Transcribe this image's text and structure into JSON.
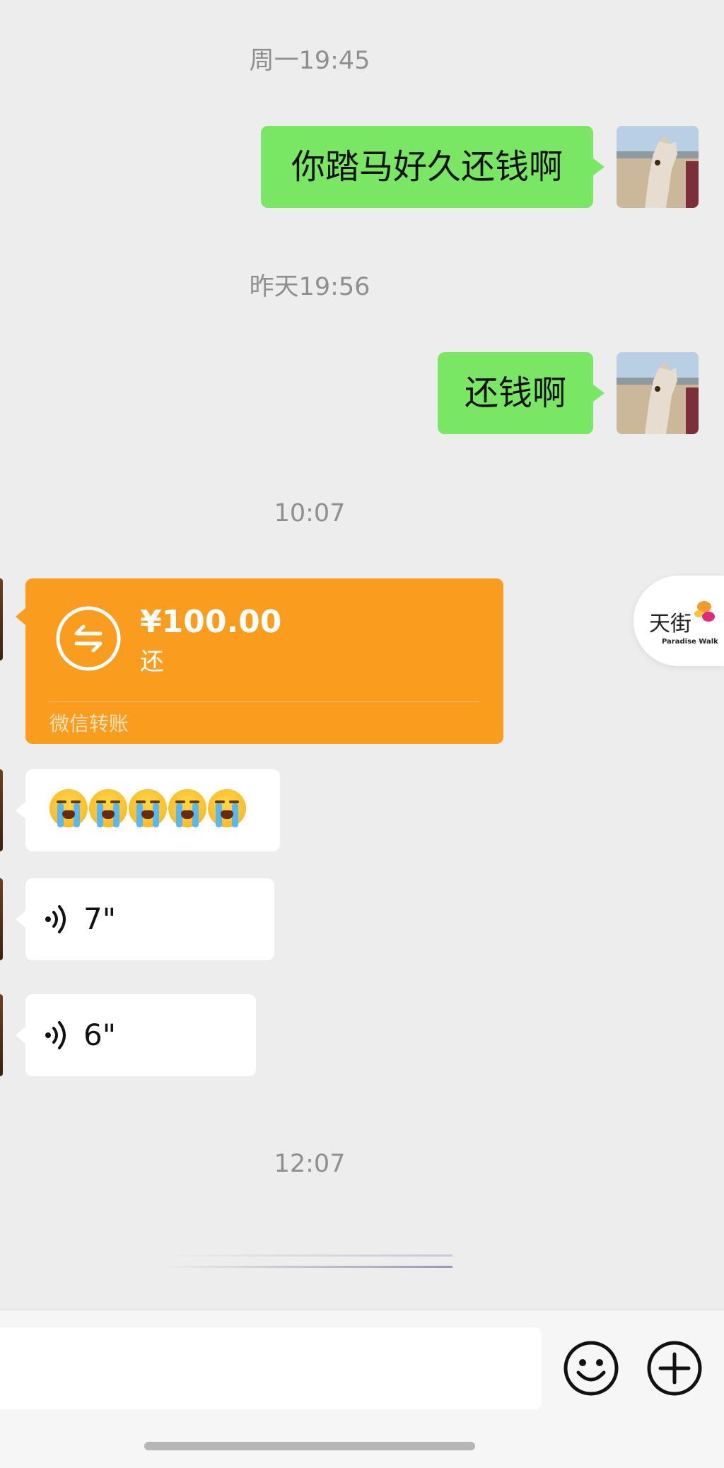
{
  "timestamps": [
    "周一19:45",
    "昨天19:56",
    "10:07",
    "12:07"
  ],
  "messages_me": [
    {
      "text": "你踏马好久还钱啊"
    },
    {
      "text": "还钱啊"
    }
  ],
  "transfer": {
    "amount": "¥100.00",
    "note": "还",
    "footer": "微信转账"
  },
  "emoji_message": {
    "emoji": "loudly-crying-face",
    "count": 5
  },
  "voice_messages": [
    {
      "duration": "7\""
    },
    {
      "duration": "6\""
    }
  ],
  "floating_ad": {
    "brand_cn": "天街",
    "brand_en": "Paradise Walk"
  },
  "colors": {
    "background": "#ededed",
    "my_bubble": "#79e664",
    "transfer": "#fa9d1e",
    "peer_bubble": "#ffffff"
  },
  "icons": {
    "transfer": "transfer-arrows-icon",
    "voice": "voice-wave-icon",
    "emoji_button": "smiley-face-icon",
    "more_button": "plus-circle-icon"
  }
}
